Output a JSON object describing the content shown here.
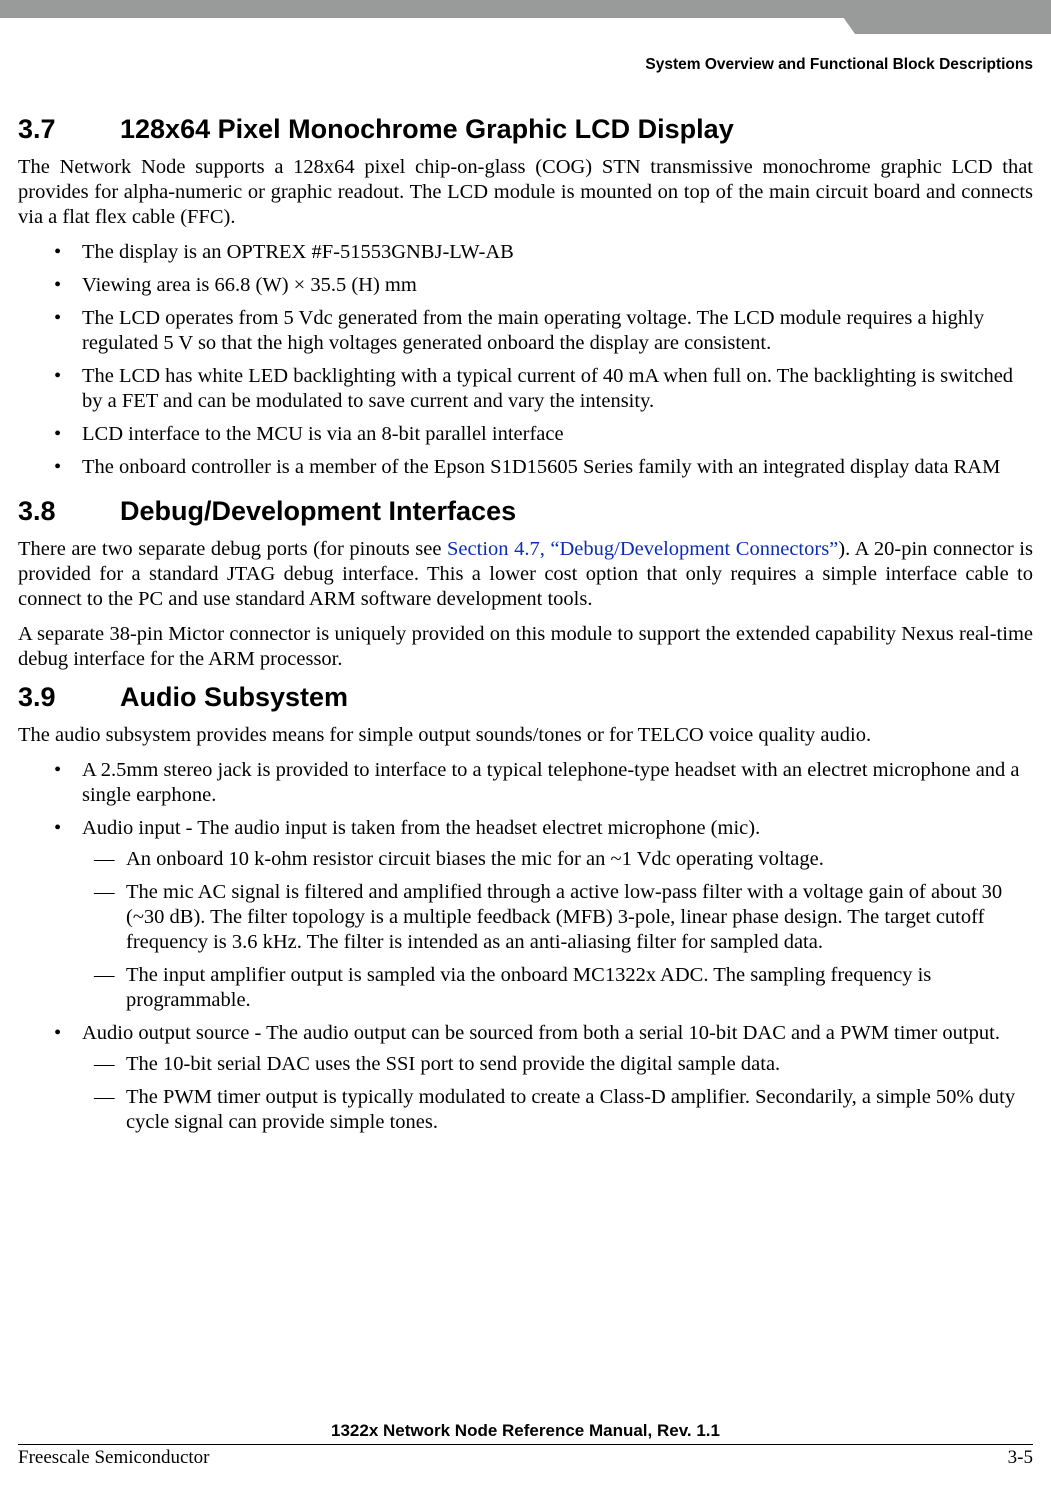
{
  "running_head": "System Overview and Functional Block Descriptions",
  "sections": {
    "s37": {
      "number": "3.7",
      "title": "128x64 Pixel Monochrome Graphic LCD Display",
      "intro": "The Network Node supports a 128x64 pixel chip-on-glass (COG) STN transmissive monochrome graphic LCD that provides for alpha-numeric or graphic readout. The LCD module is mounted on top of the main circuit board and connects via a flat flex cable (FFC).",
      "bullets": [
        "The display is an OPTREX #F-51553GNBJ-LW-AB",
        "Viewing area is 66.8 (W) × 35.5 (H) mm",
        "The LCD operates from 5 Vdc generated from the main operating voltage. The LCD module requires a highly regulated 5 V so that the high voltages generated onboard the display are consistent.",
        "The LCD has white LED backlighting with a typical current of 40 mA when full on. The backlighting is switched by a FET and can be modulated to save current and vary the intensity.",
        "LCD interface to the MCU is via an 8-bit parallel interface",
        "The onboard controller is a member of the Epson S1D15605 Series family with an integrated display data RAM"
      ]
    },
    "s38": {
      "number": "3.8",
      "title": "Debug/Development Interfaces",
      "p1_a": "There are two separate debug ports (for pinouts see ",
      "p1_link": "Section 4.7, “Debug/Development Connectors”",
      "p1_b": "). A 20-pin connector is provided for a standard JTAG debug interface. This a lower cost option that only requires a simple interface cable to connect to the PC and use standard ARM software development tools.",
      "p2": "A separate 38-pin Mictor connector is uniquely provided on this module to support the extended capability Nexus real-time debug interface for the ARM processor."
    },
    "s39": {
      "number": "3.9",
      "title": "Audio Subsystem",
      "intro": "The audio subsystem provides means for simple output sounds/tones or for TELCO voice quality audio.",
      "items": {
        "b0": "A 2.5mm stereo jack is provided to interface to a typical telephone-type headset with an electret microphone and a single earphone.",
        "b1": "Audio input - The audio input is taken from the headset electret microphone (mic).",
        "b1_subs": [
          "An onboard 10 k-ohm resistor circuit biases the mic for an ~1 Vdc operating voltage.",
          "The mic AC signal is filtered and amplified through a active low-pass filter with a voltage gain of about 30 (~30 dB). The filter topology is a multiple feedback (MFB) 3-pole, linear phase design. The target cutoff frequency is 3.6 kHz. The filter is intended as an anti-aliasing filter for sampled data.",
          "The input amplifier output is sampled via the onboard MC1322x ADC. The sampling frequency is programmable."
        ],
        "b2": "Audio output source - The audio output can be sourced from both a serial 10-bit DAC and a PWM timer output.",
        "b2_subs": [
          "The 10-bit serial DAC uses the SSI port to send provide the digital sample data.",
          "The PWM timer output is typically modulated to create a Class-D amplifier. Secondarily, a simple 50% duty cycle signal can provide simple tones."
        ]
      }
    }
  },
  "footer": {
    "title": "1322x Network Node Reference Manual, Rev. 1.1",
    "left": "Freescale Semiconductor",
    "right": "3-5"
  }
}
